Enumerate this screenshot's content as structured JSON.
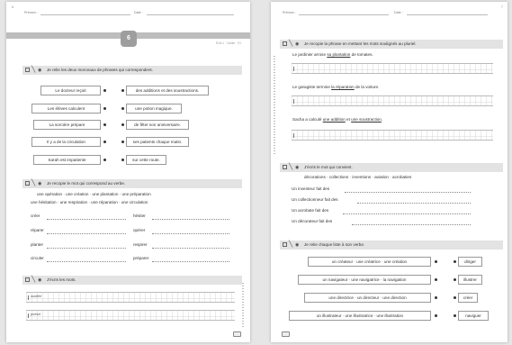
{
  "left_page": {
    "header": {
      "first_name_label": "Prénom :",
      "date_label": "Date :"
    },
    "corner": "6",
    "lesson_number": "6",
    "meta": "Écrit 1 · Cahier · S1",
    "exercise1": {
      "instruction": "Je relie les deux morceaux de phrases qui correspondent.",
      "left": [
        "Le docteur reçoit",
        "Les élèves calculent",
        "La sorcière prépare",
        "Il y a de la circulation",
        "Sarah est impatiente"
      ],
      "right": [
        "des additions et des soustractions.",
        "une potion magique.",
        "de fêter son anniversaire.",
        "ses patients chaque matin.",
        "sur cette route."
      ]
    },
    "exercise2": {
      "instruction": "Je recopie le mot qui correspond au verbe.",
      "word_bank_line1": "une opération · une création · une plantation · une préparation",
      "word_bank_line2": "une hésitation · une respiration · une réparation · une circulation",
      "verbs_left": [
        "créer",
        "réparer",
        "planter",
        "circuler"
      ],
      "verbs_right": [
        "hésiter",
        "opérer",
        "respirer",
        "préparer"
      ]
    },
    "exercise3": {
      "instruction": "J'écris les mots.",
      "models": [
        "oubliée",
        "poésie"
      ]
    }
  },
  "right_page": {
    "header": {
      "first_name_label": "Prénom :",
      "date_label": "Date :"
    },
    "corner": "7",
    "exercise1": {
      "instruction": "Je recopie la phrase en mettant les mots soulignés au pluriel.",
      "s1_before": "Le jardinier arrose ",
      "s1_under": "sa plantation",
      "s1_after": " de tomates.",
      "s2_before": "Le garagiste termine ",
      "s2_under": "la réparation",
      "s2_after": " de la voiture.",
      "s3_before": "Sacha a calculé ",
      "s3_under1": "une addition",
      "s3_mid": " et ",
      "s3_under2": "une soustraction",
      "s3_after": "."
    },
    "exercise2": {
      "instruction": "J'écris le mot qui convient.",
      "word_bank": "décorations · collections · inventions · aviation · acrobaties",
      "lines": [
        "Un inventeur fait des",
        "Un collectionneur fait des",
        "Un acrobate fait des",
        "Un décorateur fait des"
      ]
    },
    "exercise3": {
      "instruction": "Je relie chaque liste à son verbe.",
      "lists": [
        "un créateur · une créatrice · une création",
        "un navigateur · une navigatrice · la navigation",
        "une directrice · un directeur · une direction",
        "un illustrateur · une illustratrice · une illustration"
      ],
      "verbs": [
        "diriger",
        "illustrer",
        "créer",
        "naviguer"
      ]
    }
  }
}
